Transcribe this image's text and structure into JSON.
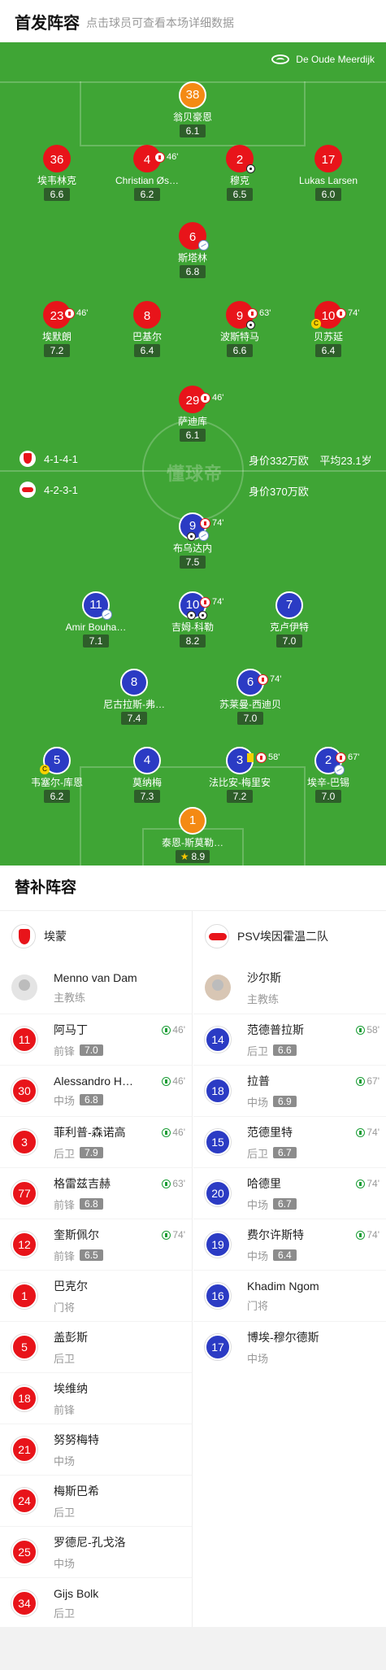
{
  "header": {
    "title": "首发阵容",
    "subtitle": "点击球员可查看本场详细数据"
  },
  "venue": "De Oude Meerdijk",
  "watermark": "懂球帝",
  "home": {
    "formation": "4-1-4-1",
    "value": "身价332万欧",
    "avg_age": "平均23.1岁",
    "players": {
      "gk": {
        "num": "38",
        "name": "翁贝豪恩",
        "rating": "6.1"
      },
      "d1": {
        "num": "36",
        "name": "埃韦林克",
        "rating": "6.6"
      },
      "d2": {
        "num": "4",
        "name": "Christian Øs…",
        "rating": "6.2",
        "sub": "46'"
      },
      "d3": {
        "num": "2",
        "name": "穆克",
        "rating": "6.5"
      },
      "d4": {
        "num": "17",
        "name": "Lukas Larsen",
        "rating": "6.0"
      },
      "dm": {
        "num": "6",
        "name": "斯塔林",
        "rating": "6.8"
      },
      "m1": {
        "num": "23",
        "name": "埃默朗",
        "rating": "7.2",
        "sub": "46'"
      },
      "m2": {
        "num": "8",
        "name": "巴基尔",
        "rating": "6.4"
      },
      "m3": {
        "num": "9",
        "name": "波斯特马",
        "rating": "6.6",
        "sub": "63'"
      },
      "m4": {
        "num": "10",
        "name": "贝苏延",
        "rating": "6.4",
        "sub": "74'"
      },
      "st": {
        "num": "29",
        "name": "萨迪库",
        "rating": "6.1",
        "sub": "46'"
      }
    }
  },
  "away": {
    "formation": "4-2-3-1",
    "value": "身价370万欧",
    "players": {
      "st": {
        "num": "9",
        "name": "布乌达内",
        "rating": "7.5",
        "sub": "74'"
      },
      "am1": {
        "num": "11",
        "name": "Amir Bouha…",
        "rating": "7.1"
      },
      "am2": {
        "num": "10",
        "name": "吉姆-科勒",
        "rating": "8.2",
        "sub": "74'"
      },
      "am3": {
        "num": "7",
        "name": "克卢伊特",
        "rating": "7.0"
      },
      "cm1": {
        "num": "8",
        "name": "尼古拉斯-弗…",
        "rating": "7.4"
      },
      "cm2": {
        "num": "6",
        "name": "苏莱曼-西迪贝",
        "rating": "7.0",
        "sub": "74'"
      },
      "d1": {
        "num": "5",
        "name": "韦塞尔-库恩",
        "rating": "6.2"
      },
      "d2": {
        "num": "4",
        "name": "莫纳梅",
        "rating": "7.3"
      },
      "d3": {
        "num": "3",
        "name": "法比安-梅里安",
        "rating": "7.2",
        "sub": "58'"
      },
      "d4": {
        "num": "2",
        "name": "埃辛-巴锡",
        "rating": "7.0",
        "sub": "67'"
      },
      "gk": {
        "num": "1",
        "name": "泰恩-斯莫勒…",
        "rating": "8.9"
      }
    }
  },
  "subs": {
    "title": "替补阵容",
    "home_team": "埃蒙",
    "away_team": "PSV埃因霍温二队",
    "coach_label": "主教练",
    "home_coach": "Menno van Dam",
    "away_coach": "沙尔斯",
    "home": [
      {
        "num": "11",
        "name": "阿马丁",
        "pos": "前锋",
        "rating": "7.0",
        "in": "46'"
      },
      {
        "num": "30",
        "name": "Alessandro H…",
        "pos": "中场",
        "rating": "6.8",
        "in": "46'"
      },
      {
        "num": "3",
        "name": "菲利普-森诺高",
        "pos": "后卫",
        "rating": "7.9",
        "in": "46'"
      },
      {
        "num": "77",
        "name": "格雷兹吉赫",
        "pos": "前锋",
        "rating": "6.8",
        "in": "63'"
      },
      {
        "num": "12",
        "name": "奎斯佩尔",
        "pos": "前锋",
        "rating": "6.5",
        "in": "74'"
      },
      {
        "num": "1",
        "name": "巴克尔",
        "pos": "门将"
      },
      {
        "num": "5",
        "name": "盖彭斯",
        "pos": "后卫"
      },
      {
        "num": "18",
        "name": "埃维纳",
        "pos": "前锋"
      },
      {
        "num": "21",
        "name": "努努梅特",
        "pos": "中场"
      },
      {
        "num": "24",
        "name": "梅斯巴希",
        "pos": "后卫"
      },
      {
        "num": "25",
        "name": "罗德尼-孔戈洛",
        "pos": "中场"
      },
      {
        "num": "34",
        "name": "Gijs Bolk",
        "pos": "后卫"
      }
    ],
    "away": [
      {
        "num": "14",
        "name": "范德普拉斯",
        "pos": "后卫",
        "rating": "6.6",
        "in": "58'"
      },
      {
        "num": "18",
        "name": "拉普",
        "pos": "中场",
        "rating": "6.9",
        "in": "67'"
      },
      {
        "num": "15",
        "name": "范德里特",
        "pos": "后卫",
        "rating": "6.7",
        "in": "74'"
      },
      {
        "num": "20",
        "name": "哈德里",
        "pos": "中场",
        "rating": "6.7",
        "in": "74'"
      },
      {
        "num": "19",
        "name": "费尔许斯特",
        "pos": "中场",
        "rating": "6.4",
        "in": "74'"
      },
      {
        "num": "16",
        "name": "Khadim Ngom",
        "pos": "门将"
      },
      {
        "num": "17",
        "name": "博埃-穆尔德斯",
        "pos": "中场"
      }
    ]
  }
}
